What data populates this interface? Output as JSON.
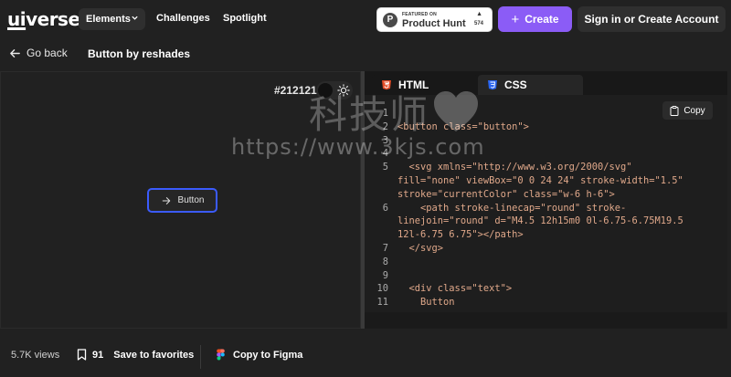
{
  "nav": {
    "logo_prefix": "ui",
    "logo_suffix": "verse",
    "elements": "Elements",
    "challenges": "Challenges",
    "spotlight": "Spotlight",
    "product_hunt": {
      "featured": "FEATURED ON",
      "name": "Product Hunt",
      "count": "574"
    },
    "create": "Create",
    "signin": "Sign in or Create Account"
  },
  "subheader": {
    "go_back": "Go back",
    "title": "Button by reshades"
  },
  "preview": {
    "bg_color": "#212121",
    "button_label": "Button",
    "accent": "#3b5bfd"
  },
  "code": {
    "tabs": [
      {
        "label": "HTML",
        "icon": "html5-icon"
      },
      {
        "label": "CSS",
        "icon": "css3-icon"
      }
    ],
    "copy": "Copy",
    "lines": [
      {
        "n": "1",
        "text": ""
      },
      {
        "n": "2",
        "text": "<button class=\"button\">"
      },
      {
        "n": "3",
        "text": ""
      },
      {
        "n": "4",
        "text": ""
      },
      {
        "n": "5",
        "text": "  <svg xmlns=\"http://www.w3.org/2000/svg\""
      },
      {
        "n": "",
        "text": "fill=\"none\" viewBox=\"0 0 24 24\" stroke-width=\"1.5\""
      },
      {
        "n": "",
        "text": "stroke=\"currentColor\" class=\"w-6 h-6\">"
      },
      {
        "n": "6",
        "text": "    <path stroke-linecap=\"round\" stroke-"
      },
      {
        "n": "",
        "text": "linejoin=\"round\" d=\"M4.5 12h15m0 0l-6.75-6.75M19.5"
      },
      {
        "n": "",
        "text": "12l-6.75 6.75\"></path>"
      },
      {
        "n": "7",
        "text": "  </svg>"
      },
      {
        "n": "8",
        "text": ""
      },
      {
        "n": "9",
        "text": ""
      },
      {
        "n": "10",
        "text": "  <div class=\"text\">"
      },
      {
        "n": "11",
        "text": "    Button"
      }
    ]
  },
  "watermark": {
    "cn": "科技师",
    "url": "https://www.3kjs.com"
  },
  "footer": {
    "views": "5.7K views",
    "fav_count": "91",
    "fav_label": "Save to favorites",
    "figma": "Copy to Figma"
  }
}
